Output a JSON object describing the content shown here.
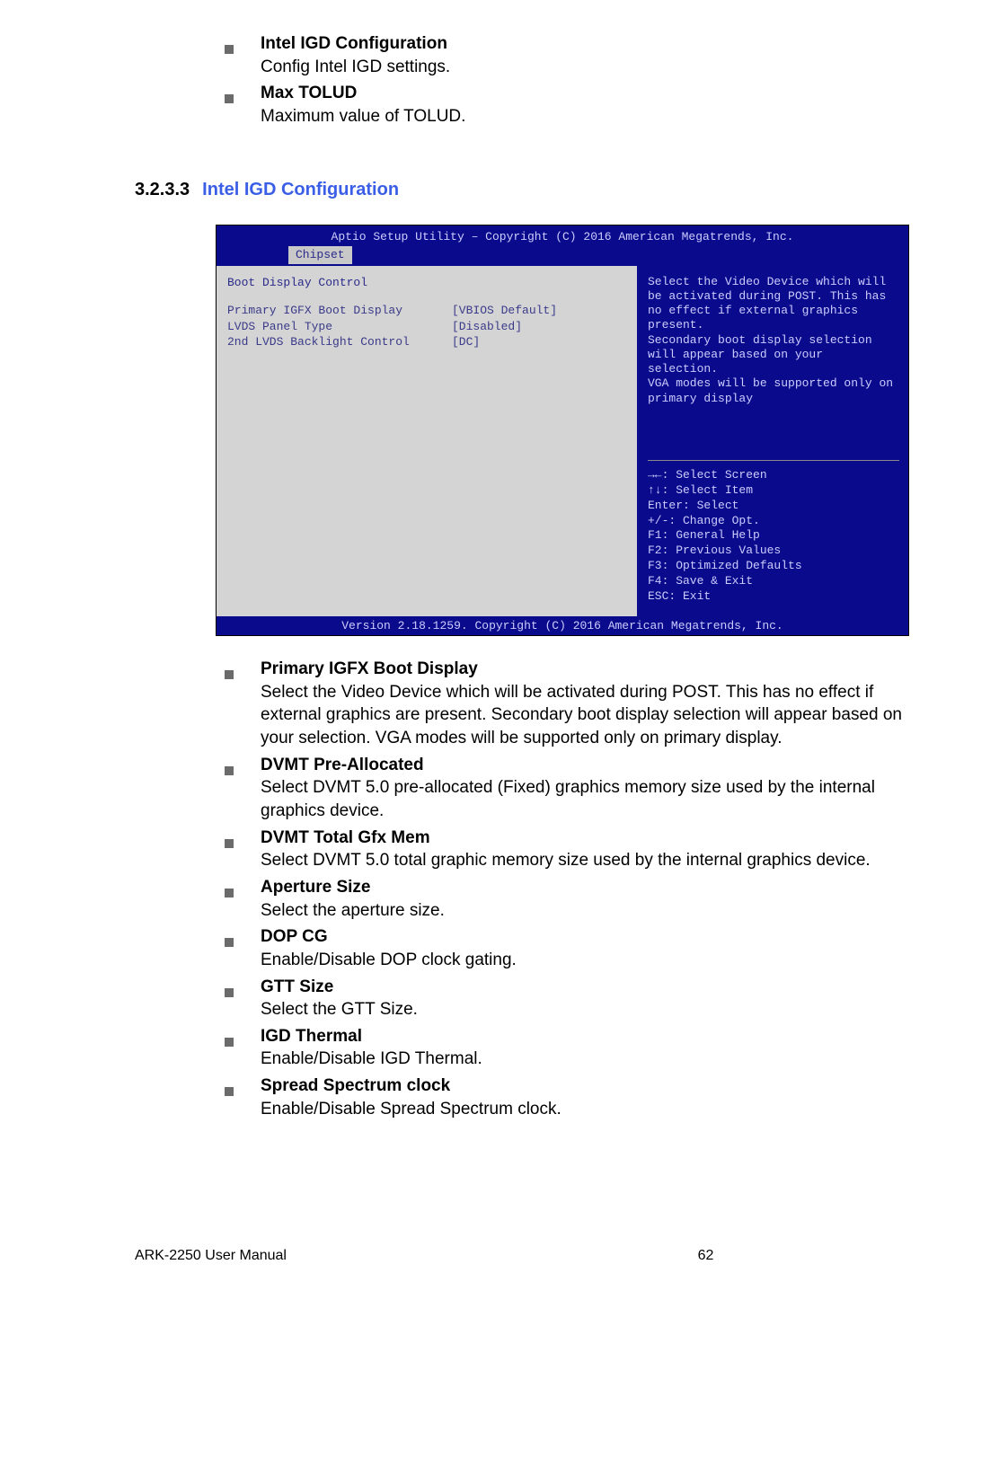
{
  "top_items": [
    {
      "term": "Intel IGD Configuration",
      "desc": "Config Intel IGD settings."
    },
    {
      "term": "Max TOLUD",
      "desc": "Maximum value of TOLUD."
    }
  ],
  "section": {
    "num": "3.2.3.3",
    "title": "Intel IGD Configuration"
  },
  "bios": {
    "title": "Aptio Setup Utility – Copyright (C) 2016 American Megatrends, Inc.",
    "tab": "Chipset",
    "left_header": "Boot Display Control",
    "rows": [
      {
        "label": "Primary IGFX Boot Display",
        "value": "[VBIOS Default]"
      },
      {
        "label": "LVDS Panel Type",
        "value": "[Disabled]"
      },
      {
        "label": "2nd LVDS Backlight Control",
        "value": "[DC]"
      }
    ],
    "help": "Select the Video Device which will be activated during POST. This has no effect if external graphics present.\nSecondary boot display selection will appear based on your selection.\nVGA modes will be supported only on primary display",
    "nav": [
      "→←: Select Screen",
      "↑↓: Select Item",
      "Enter: Select",
      "+/-: Change Opt.",
      "F1: General Help",
      "F2: Previous Values",
      "F3: Optimized Defaults",
      "F4: Save & Exit",
      "ESC: Exit"
    ],
    "footer": "Version 2.18.1259. Copyright (C) 2016 American Megatrends, Inc."
  },
  "options": [
    {
      "term": "Primary IGFX Boot Display",
      "desc": "Select the Video Device which will be activated during POST. This has no effect if external graphics are present. Secondary boot display selection will appear based on your selection. VGA modes will be supported only on primary display."
    },
    {
      "term": "DVMT Pre-Allocated",
      "desc": "Select DVMT 5.0 pre-allocated (Fixed) graphics memory size used by the internal graphics device."
    },
    {
      "term": "DVMT Total Gfx Mem",
      "desc": "Select DVMT 5.0 total graphic memory size used by the internal graphics device."
    },
    {
      "term": "Aperture Size",
      "desc": "Select the aperture size."
    },
    {
      "term": "DOP CG",
      "desc": "Enable/Disable DOP clock gating."
    },
    {
      "term": "GTT Size",
      "desc": "Select the GTT Size."
    },
    {
      "term": "IGD Thermal",
      "desc": "Enable/Disable IGD Thermal."
    },
    {
      "term": "Spread Spectrum clock",
      "desc": "Enable/Disable Spread Spectrum clock."
    }
  ],
  "footer": {
    "left": "ARK-2250 User Manual",
    "page": "62"
  }
}
